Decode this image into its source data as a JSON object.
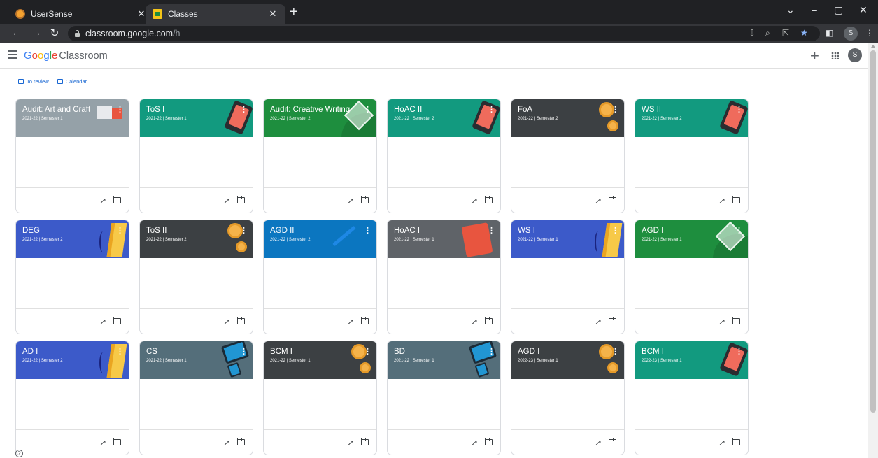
{
  "browser": {
    "tabs": [
      {
        "title": "UserSense",
        "active": false
      },
      {
        "title": "Classes",
        "active": true
      }
    ],
    "url_host": "classroom.google.com",
    "url_path": "/h",
    "profile_initial": "S"
  },
  "app": {
    "logo_google": [
      "G",
      "o",
      "o",
      "g",
      "l",
      "e"
    ],
    "logo_product": "Classroom",
    "avatar_initial": "S"
  },
  "subnav": {
    "to_review": "To review",
    "calendar": "Calendar"
  },
  "theme": {
    "slate": "#95a1a8",
    "teal": "#129a7f",
    "green": "#1e8e3e",
    "dark": "#3c4043",
    "blue": "#3c5ac9",
    "steelblue": "#0b76c0",
    "gray": "#5f6368",
    "bluegray": "#546e7a"
  },
  "classes": [
    {
      "title": "Audit: Art and Craft",
      "subtitle": "2021-22 | Semester 1",
      "color": "#95a1a8",
      "art": "flags"
    },
    {
      "title": "ToS I",
      "subtitle": "2021-22 | Semester 1",
      "color": "#129a7f",
      "art": "tablet"
    },
    {
      "title": "Audit: Creative Writing",
      "subtitle": "2021-22 | Semester 2",
      "color": "#1e8e3e",
      "art": "diamond"
    },
    {
      "title": "HoAC II",
      "subtitle": "2021-22 | Semester 2",
      "color": "#129a7f",
      "art": "tablet"
    },
    {
      "title": "FoA",
      "subtitle": "2021-22 | Semester 2",
      "color": "#3c4043",
      "art": "coins"
    },
    {
      "title": "WS II",
      "subtitle": "2021-22 | Semester 2",
      "color": "#129a7f",
      "art": "tablet"
    },
    {
      "title": "DEG",
      "subtitle": "2021-22 | Semester 2",
      "color": "#3c5ac9",
      "art": "book"
    },
    {
      "title": "ToS II",
      "subtitle": "2021-22 | Semester 2",
      "color": "#3c4043",
      "art": "coins"
    },
    {
      "title": "AGD II",
      "subtitle": "2021-22 | Semester 2",
      "color": "#0b76c0",
      "art": "pencil"
    },
    {
      "title": "HoAC I",
      "subtitle": "2021-22 | Semester 1",
      "color": "#5f6368",
      "art": "redbook"
    },
    {
      "title": "WS I",
      "subtitle": "2021-22 | Semester 1",
      "color": "#3c5ac9",
      "art": "book"
    },
    {
      "title": "AGD I",
      "subtitle": "2021-22 | Semester 1",
      "color": "#1e8e3e",
      "art": "diamond"
    },
    {
      "title": "AD I",
      "subtitle": "2021-22 | Semester 2",
      "color": "#3c5ac9",
      "art": "book"
    },
    {
      "title": "CS",
      "subtitle": "2021-22 | Semester 1",
      "color": "#546e7a",
      "art": "device"
    },
    {
      "title": "BCM I",
      "subtitle": "2021-22 | Semester 1",
      "color": "#3c4043",
      "art": "coins"
    },
    {
      "title": "BD",
      "subtitle": "2021-22 | Semester 1",
      "color": "#546e7a",
      "art": "device"
    },
    {
      "title": "AGD I",
      "subtitle": "2022-23 | Semester 1",
      "color": "#3c4043",
      "art": "coins"
    },
    {
      "title": "BCM I",
      "subtitle": "2022-23 | Semester 1",
      "color": "#129a7f",
      "art": "tablet"
    }
  ]
}
